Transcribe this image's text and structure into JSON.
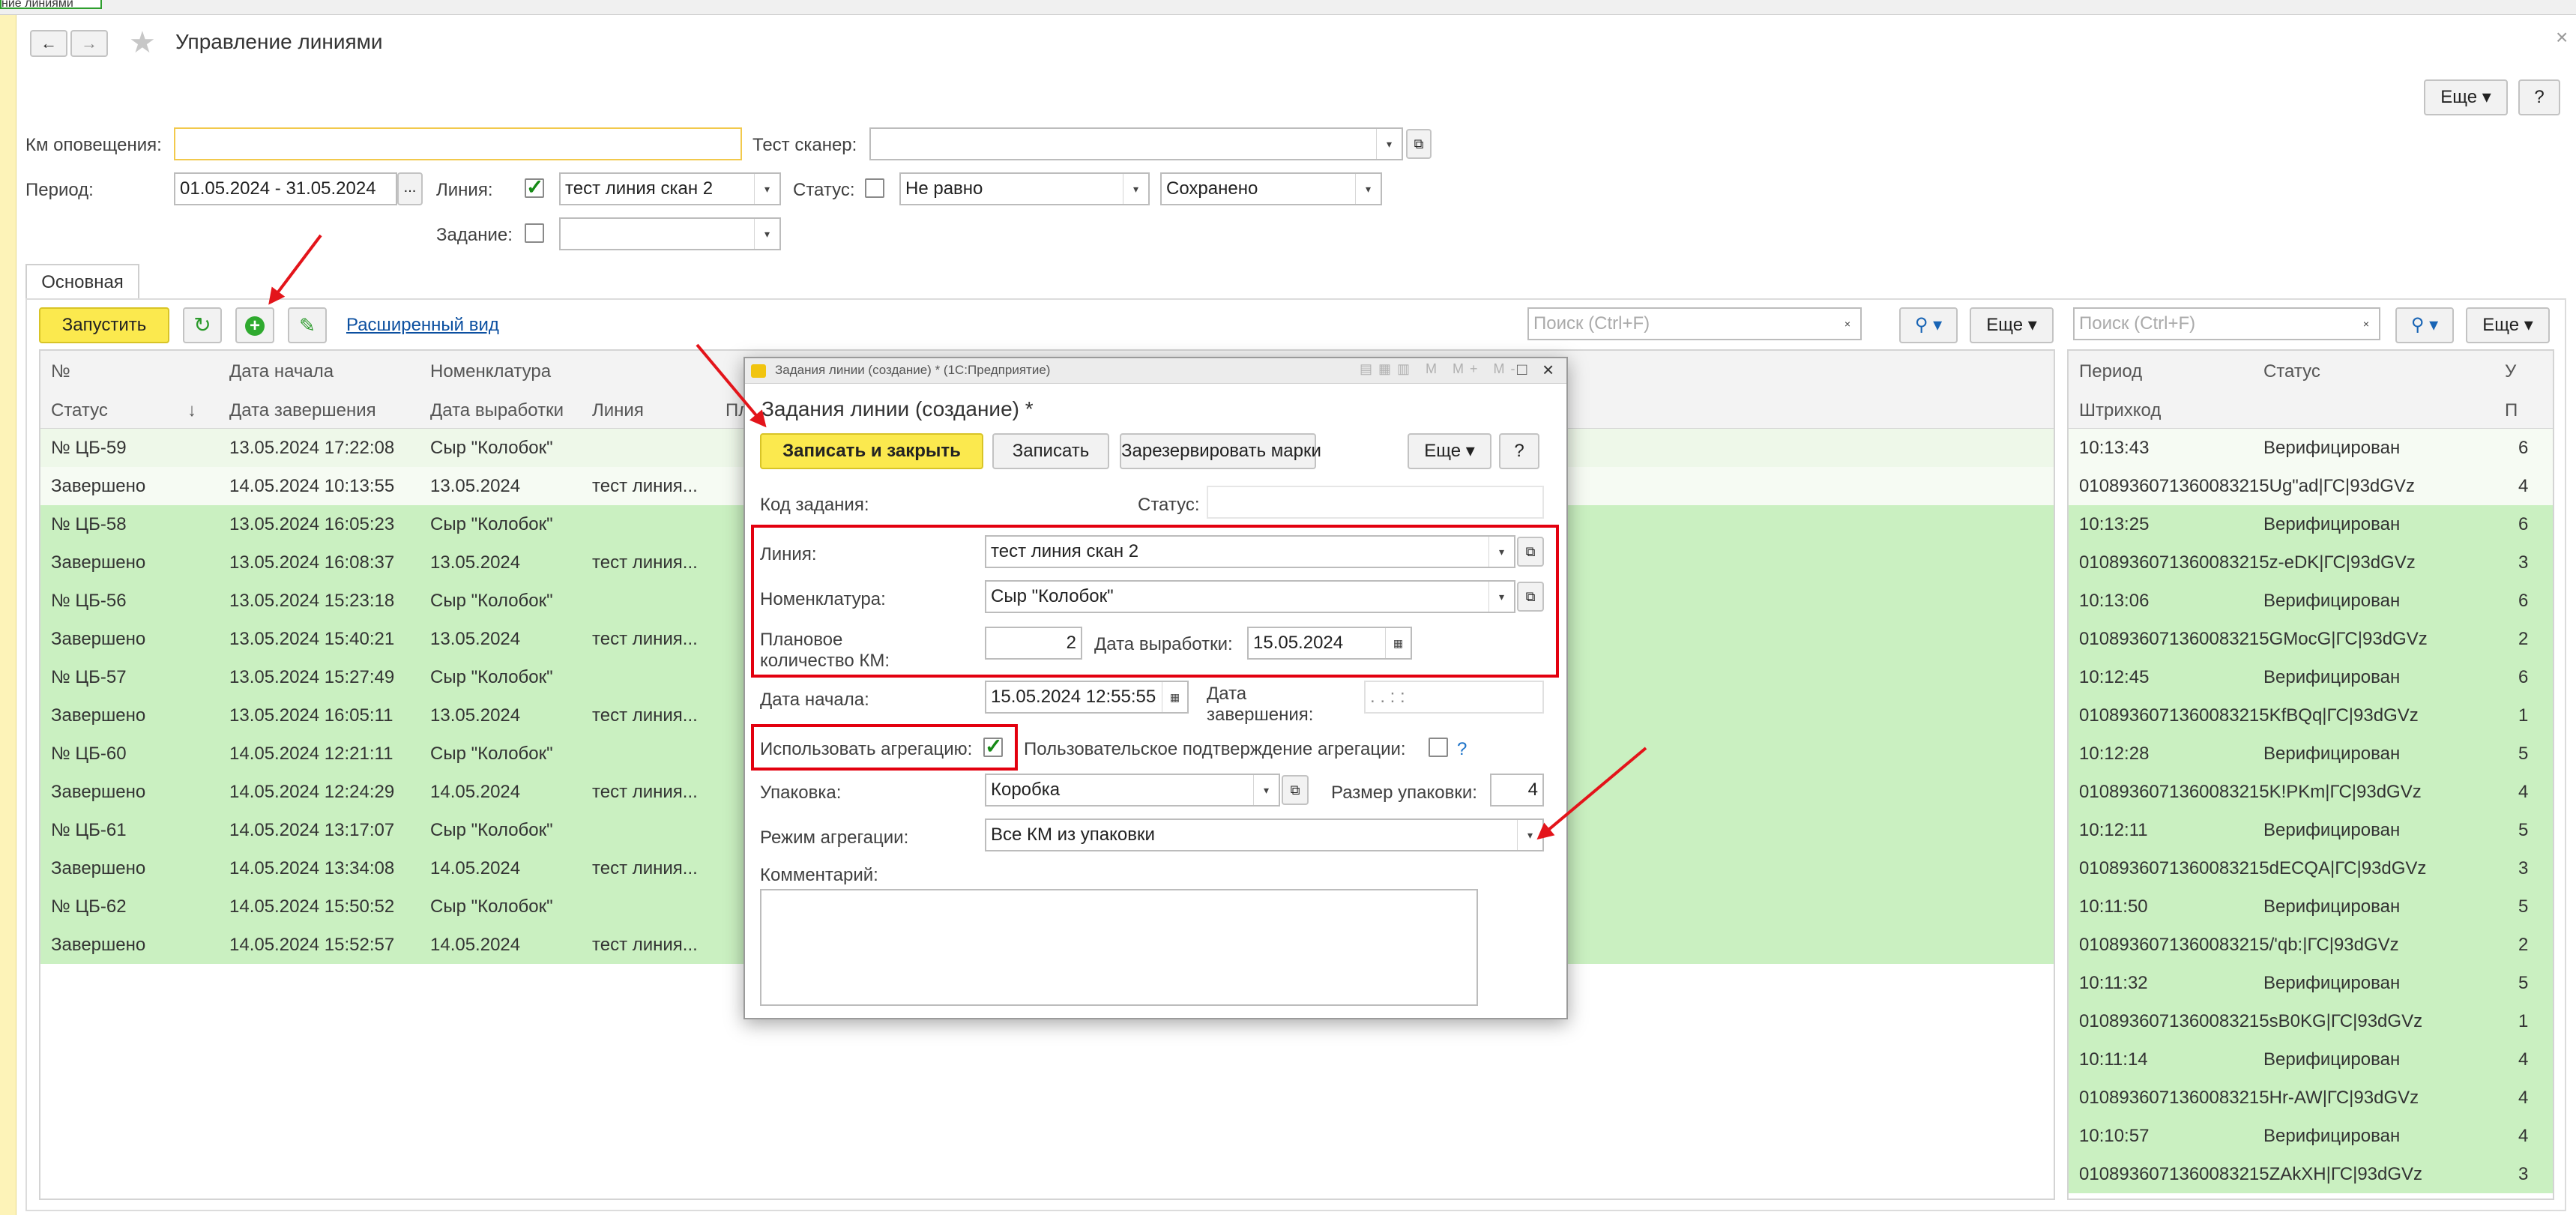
{
  "window": {
    "tab_label": "ние линиями",
    "title": "Управление линиями",
    "close_glyph": "×",
    "more_label": "Еще",
    "help_label": "?"
  },
  "filters": {
    "km_label": "Км оповещения:",
    "km_value": "",
    "scanner_label": "Тест сканер:",
    "scanner_value": "",
    "period_label": "Период:",
    "period_value": "01.05.2024 - 31.05.2024",
    "period_btn": "...",
    "line_label": "Линия:",
    "line_checked": true,
    "line_value": "тест линия скан 2",
    "status_label": "Статус:",
    "status_checked": false,
    "status_cond": "Не равно",
    "status_value": "Сохранено",
    "task_label": "Задание:",
    "task_checked": false,
    "task_value": ""
  },
  "tabs": [
    "Основная"
  ],
  "toolbar": {
    "run_label": "Запустить",
    "extended_view": "Расширенный вид",
    "search_placeholder": "Поиск (Ctrl+F)",
    "more_label": "Еще"
  },
  "main_table": {
    "headers_top": [
      "№",
      "Дата начала",
      "Номенклатура",
      "Пл"
    ],
    "headers_bottom": [
      "Статус",
      "Дата завершения",
      "Дата выработки",
      "Линия"
    ],
    "sort_glyph": "↓",
    "rows": [
      {
        "a": "№ ЦБ-59",
        "b": "13.05.2024 17:22:08",
        "c": "Сыр \"Колобок\"",
        "d": ""
      },
      {
        "a": "Завершено",
        "b": "14.05.2024 10:13:55",
        "c": "13.05.2024",
        "d": "тест линия..."
      },
      {
        "a": "№ ЦБ-58",
        "b": "13.05.2024 16:05:23",
        "c": "Сыр \"Колобок\"",
        "d": ""
      },
      {
        "a": "Завершено",
        "b": "13.05.2024 16:08:37",
        "c": "13.05.2024",
        "d": "тест линия..."
      },
      {
        "a": "№ ЦБ-56",
        "b": "13.05.2024 15:23:18",
        "c": "Сыр \"Колобок\"",
        "d": ""
      },
      {
        "a": "Завершено",
        "b": "13.05.2024 15:40:21",
        "c": "13.05.2024",
        "d": "тест линия..."
      },
      {
        "a": "№ ЦБ-57",
        "b": "13.05.2024 15:27:49",
        "c": "Сыр \"Колобок\"",
        "d": ""
      },
      {
        "a": "Завершено",
        "b": "13.05.2024 16:05:11",
        "c": "13.05.2024",
        "d": "тест линия..."
      },
      {
        "a": "№ ЦБ-60",
        "b": "14.05.2024 12:21:11",
        "c": "Сыр \"Колобок\"",
        "d": ""
      },
      {
        "a": "Завершено",
        "b": "14.05.2024 12:24:29",
        "c": "14.05.2024",
        "d": "тест линия..."
      },
      {
        "a": "№ ЦБ-61",
        "b": "14.05.2024 13:17:07",
        "c": "Сыр \"Колобок\"",
        "d": ""
      },
      {
        "a": "Завершено",
        "b": "14.05.2024 13:34:08",
        "c": "14.05.2024",
        "d": "тест линия..."
      },
      {
        "a": "№ ЦБ-62",
        "b": "14.05.2024 15:50:52",
        "c": "Сыр \"Колобок\"",
        "d": ""
      },
      {
        "a": "Завершено",
        "b": "14.05.2024 15:52:57",
        "c": "14.05.2024",
        "d": "тест линия..."
      }
    ]
  },
  "right_table": {
    "headers_top": [
      "Период",
      "Статус",
      "У"
    ],
    "headers_bottom": [
      "Штрихкод",
      "П"
    ],
    "rows": [
      {
        "a": "10:13:43",
        "b": "Верифицирован",
        "c": "6"
      },
      {
        "a": "0108936071360083215Ug\"ad|ГС|93dGVz",
        "b": "",
        "c": "4"
      },
      {
        "a": "10:13:25",
        "b": "Верифицирован",
        "c": "6"
      },
      {
        "a": "0108936071360083215z-eDK|ГС|93dGVz",
        "b": "",
        "c": "3"
      },
      {
        "a": "10:13:06",
        "b": "Верифицирован",
        "c": "6"
      },
      {
        "a": "0108936071360083215GMocG|ГС|93dGVz",
        "b": "",
        "c": "2"
      },
      {
        "a": "10:12:45",
        "b": "Верифицирован",
        "c": "6"
      },
      {
        "a": "0108936071360083215KfBQq|ГС|93dGVz",
        "b": "",
        "c": "1"
      },
      {
        "a": "10:12:28",
        "b": "Верифицирован",
        "c": "5"
      },
      {
        "a": "0108936071360083215K!PKm|ГС|93dGVz",
        "b": "",
        "c": "4"
      },
      {
        "a": "10:12:11",
        "b": "Верифицирован",
        "c": "5"
      },
      {
        "a": "0108936071360083215dECQA|ГС|93dGVz",
        "b": "",
        "c": "3"
      },
      {
        "a": "10:11:50",
        "b": "Верифицирован",
        "c": "5"
      },
      {
        "a": "0108936071360083215/'qb:|ГС|93dGVz",
        "b": "",
        "c": "2"
      },
      {
        "a": "10:11:32",
        "b": "Верифицирован",
        "c": "5"
      },
      {
        "a": "0108936071360083215sB0KG|ГС|93dGVz",
        "b": "",
        "c": "1"
      },
      {
        "a": "10:11:14",
        "b": "Верифицирован",
        "c": "4"
      },
      {
        "a": "0108936071360083215Hr-AW|ГС|93dGVz",
        "b": "",
        "c": "4"
      },
      {
        "a": "10:10:57",
        "b": "Верифицирован",
        "c": "4"
      },
      {
        "a": "0108936071360083215ZAkXH|ГС|93dGVz",
        "b": "",
        "c": "3"
      }
    ]
  },
  "dialog": {
    "titlebar": "Задания линии (создание) * (1С:Предприятие)",
    "title": "Задания линии (создание) *",
    "save_close": "Записать и закрыть",
    "save": "Записать",
    "reserve": "Зарезервировать марки",
    "more": "Еще",
    "help": "?",
    "code_label": "Код задания:",
    "status_label": "Статус:",
    "status_value": "",
    "line_label": "Линия:",
    "line_value": "тест линия скан 2",
    "nomen_label": "Номенклатура:",
    "nomen_value": "Сыр \"Колобок\"",
    "plan_label_1": "Плановое",
    "plan_label_2": "количество КМ:",
    "plan_value": "2",
    "prod_date_label": "Дата выработки:",
    "prod_date_value": "15.05.2024",
    "start_label": "Дата начала:",
    "start_value": "15.05.2024 12:55:55",
    "end_label_1": "Дата",
    "end_label_2": "завершения:",
    "end_value": " .  .       :  :",
    "aggr_label": "Использовать агрегацию:",
    "aggr_checked": true,
    "user_confirm_label": "Пользовательское подтверждение агрегации:",
    "user_confirm_checked": false,
    "qmark": "?",
    "pack_label": "Упаковка:",
    "pack_value": "Коробка",
    "pack_size_label": "Размер упаковки:",
    "pack_size_value": "4",
    "mode_label": "Режим агрегации:",
    "mode_value": "Все КМ из упаковки",
    "comment_label": "Комментарий:",
    "comment_value": ""
  }
}
